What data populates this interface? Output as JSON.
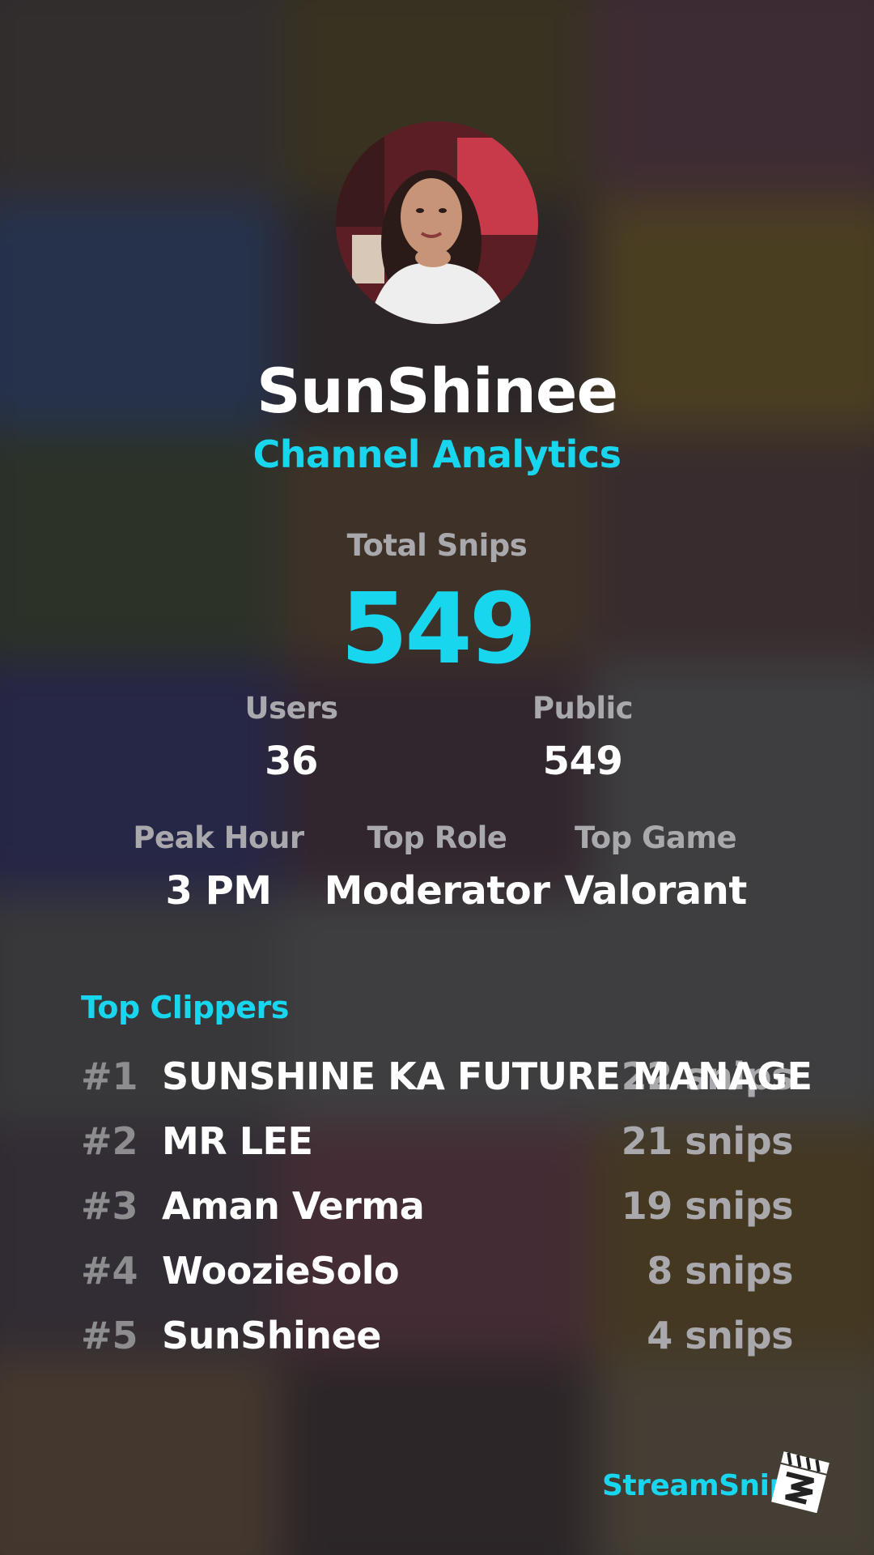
{
  "header": {
    "channel_name": "SunShinee",
    "subtitle": "Channel Analytics"
  },
  "stats": {
    "total_snips_label": "Total Snips",
    "total_snips_value": "549",
    "users_label": "Users",
    "users_value": "36",
    "public_label": "Public",
    "public_value": "549",
    "peak_hour_label": "Peak Hour",
    "peak_hour_value": "3 PM",
    "top_role_label": "Top Role",
    "top_role_value": "Moderator",
    "top_game_label": "Top Game",
    "top_game_value": "Valorant"
  },
  "top_clippers": {
    "title": "Top Clippers",
    "items": [
      {
        "rank": "#1",
        "name": "SUNSHINE KA FUTURE MANAGE",
        "count": "22 snips"
      },
      {
        "rank": "#2",
        "name": "MR LEE",
        "count": "21 snips"
      },
      {
        "rank": "#3",
        "name": "Aman Verma",
        "count": "19 snips"
      },
      {
        "rank": "#4",
        "name": "WoozieSolo",
        "count": "8 snips"
      },
      {
        "rank": "#5",
        "name": "SunShinee",
        "count": "4 snips"
      }
    ]
  },
  "footer": {
    "brand": "StreamSnip"
  },
  "colors": {
    "accent": "#17d6ee",
    "label_gray": "#a9a9ad",
    "rank_gray": "#8d8d90",
    "text_white": "#ffffff"
  },
  "icons": {
    "logo": "clapperboard-logo-icon"
  }
}
